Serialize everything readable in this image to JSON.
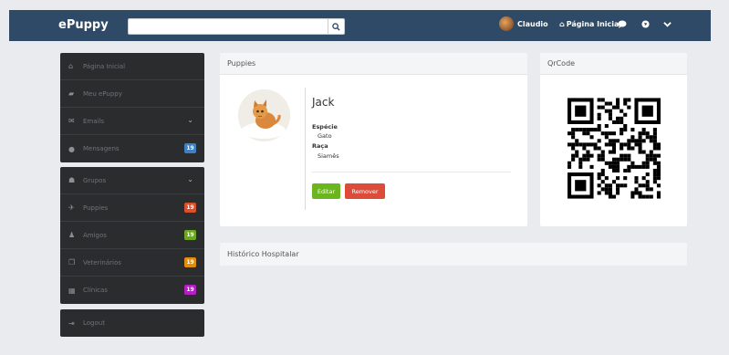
{
  "app": {
    "brand": "ePuppy"
  },
  "navbar": {
    "search_placeholder": "",
    "search_icon": "search-icon",
    "user_name": "Claudio",
    "home_label": "Página Inicial",
    "icons": [
      "chat-icon",
      "globe-icon",
      "chevron-down-icon"
    ]
  },
  "sidebar": {
    "group1": [
      {
        "label": "Página Inicial",
        "icon": "home-icon"
      },
      {
        "label": "Meu ePuppy",
        "icon": "book-icon"
      },
      {
        "label": "Emails",
        "icon": "envelope-icon",
        "chevron": true
      },
      {
        "label": "Mensagens",
        "icon": "chat-icon",
        "badge": "19",
        "badge_color": "#3f7fc3"
      }
    ],
    "group2": [
      {
        "label": "Grupos",
        "icon": "users-icon",
        "chevron": true
      },
      {
        "label": "Puppies",
        "icon": "bird-icon",
        "badge": "19",
        "badge_color": "#d9502b"
      },
      {
        "label": "Amigos",
        "icon": "user-icon",
        "badge": "19",
        "badge_color": "#6aa81f"
      },
      {
        "label": "Veterinários",
        "icon": "copy-icon",
        "badge": "19",
        "badge_color": "#e08e0b"
      },
      {
        "label": "Clínicas",
        "icon": "table-icon",
        "badge": "19",
        "badge_color": "#b51ec4"
      }
    ],
    "group3": [
      {
        "label": "Logout",
        "icon": "signout-icon"
      }
    ]
  },
  "puppies": {
    "header": "Puppies",
    "name": "Jack",
    "species_label": "Espécie",
    "species_value": "Gato",
    "breed_label": "Raça",
    "breed_value": "Siamês",
    "edit_label": "Editar",
    "remove_label": "Remover",
    "edit_color": "#6bb51e",
    "remove_color": "#dd4b39"
  },
  "qrcode": {
    "header": "QrCode"
  },
  "history": {
    "header": "Histórico Hospitalar"
  }
}
